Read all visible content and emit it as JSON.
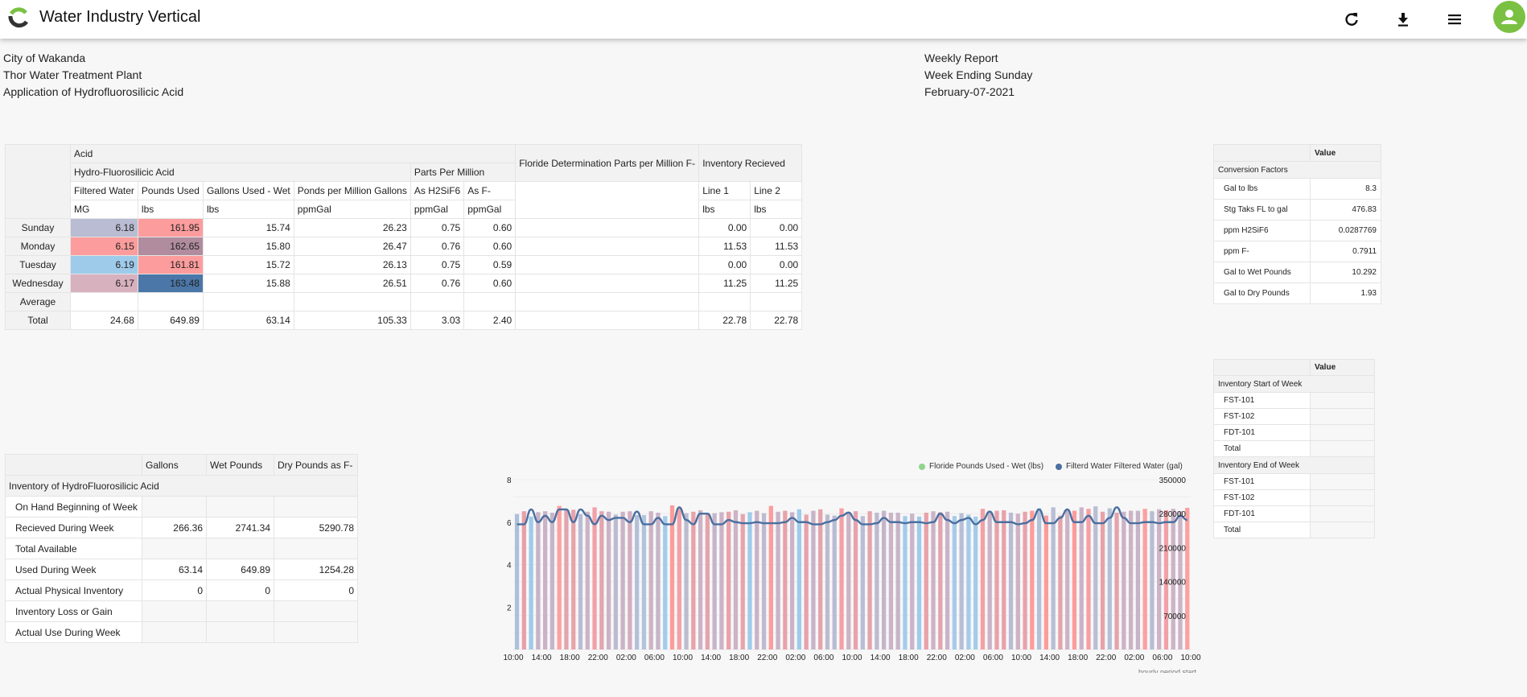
{
  "app": {
    "title": "Water Industry Vertical",
    "icons": [
      "refresh-icon",
      "download-icon",
      "menu-icon",
      "user-icon"
    ]
  },
  "header": {
    "left": [
      "City of Wakanda",
      "Thor Water Treatment Plant",
      "Application of Hydrofluorosilicic Acid"
    ],
    "right": [
      "Weekly Report",
      "Week Ending Sunday",
      "February-07-2021"
    ]
  },
  "main_table": {
    "group1": "Acid",
    "group2a": "Hydro-Fluorosilicic Acid",
    "group2b": "Parts Per Million",
    "floride_col": "Floride Determination Parts per Million F-",
    "inventory_col": "Inventory Recieved",
    "columns": [
      "Filtered Water",
      "Pounds Used",
      "Gallons Used - Wet",
      "Ponds per Million Gallons",
      "As H2SiF6",
      "As F-",
      "",
      "Line 1",
      "Line 2"
    ],
    "units": [
      "MG",
      "lbs",
      "lbs",
      "ppmGal",
      "ppmGal",
      "ppmGal",
      "",
      "lbs",
      "lbs"
    ],
    "rows": [
      {
        "label": "Sunday",
        "values": [
          "6.18",
          "161.95",
          "15.74",
          "26.23",
          "0.75",
          "0.60",
          "",
          "0.00",
          "0.00"
        ],
        "colors": [
          "#b9bcd3",
          "#fc9c9c"
        ]
      },
      {
        "label": "Monday",
        "values": [
          "6.15",
          "162.65",
          "15.80",
          "26.47",
          "0.76",
          "0.60",
          "",
          "11.53",
          "11.53"
        ],
        "colors": [
          "#fc9c9c",
          "#b08c9e"
        ]
      },
      {
        "label": "Tuesday",
        "values": [
          "6.19",
          "161.81",
          "15.72",
          "26.13",
          "0.75",
          "0.59",
          "",
          "0.00",
          "0.00"
        ],
        "colors": [
          "#9fcbea",
          "#fc9c9c"
        ]
      },
      {
        "label": "Wednesday",
        "values": [
          "6.17",
          "163.48",
          "15.88",
          "26.51",
          "0.76",
          "0.60",
          "",
          "11.25",
          "11.25"
        ],
        "colors": [
          "#d8b1bf",
          "#4a77a8"
        ]
      },
      {
        "label": "Average",
        "values": [
          "",
          "",
          "",
          "",
          "",
          "",
          "",
          "",
          ""
        ],
        "colors": [
          "",
          ""
        ]
      },
      {
        "label": "Total",
        "values": [
          "24.68",
          "649.89",
          "63.14",
          "105.33",
          "3.03",
          "2.40",
          "",
          "22.78",
          "22.78"
        ],
        "colors": [
          "",
          ""
        ]
      }
    ]
  },
  "inventory_table": {
    "columns": [
      "Gallons",
      "Wet Pounds",
      "Dry Pounds as F-"
    ],
    "section": "Inventory of HydroFluorosilicic Acid",
    "rows": [
      {
        "label": "On Hand Beginning of Week",
        "values": [
          "",
          "",
          ""
        ]
      },
      {
        "label": "Recieved During Week",
        "values": [
          "266.36",
          "2741.34",
          "5290.78"
        ]
      },
      {
        "label": "Total Available",
        "values": [
          "",
          "",
          ""
        ]
      },
      {
        "label": "Used During Week",
        "values": [
          "63.14",
          "649.89",
          "1254.28"
        ]
      },
      {
        "label": "Actual Physical Inventory",
        "values": [
          "0",
          "0",
          "0"
        ]
      },
      {
        "label": "Inventory Loss or Gain",
        "values": [
          "",
          "",
          ""
        ]
      },
      {
        "label": "Actual Use During Week",
        "values": [
          "",
          "",
          ""
        ]
      }
    ]
  },
  "conversion_table": {
    "value_header": "Value",
    "section": "Conversion Factors",
    "rows": [
      {
        "label": "Gal to lbs",
        "value": "8.3"
      },
      {
        "label": "Stg Taks FL to gal",
        "value": "476.83"
      },
      {
        "label": "ppm H2SiF6",
        "value": "0.0287769"
      },
      {
        "label": "ppm F-",
        "value": "0.7911"
      },
      {
        "label": "Gal to Wet Pounds",
        "value": "10.292"
      },
      {
        "label": "Gal to Dry Pounds",
        "value": "1.93"
      }
    ]
  },
  "stock_table": {
    "value_header": "Value",
    "sections": [
      {
        "title": "Inventory Start of Week",
        "rows": [
          {
            "label": "FST-101",
            "value": ""
          },
          {
            "label": "FST-102",
            "value": ""
          },
          {
            "label": "FDT-101",
            "value": ""
          },
          {
            "label": "Total",
            "value": ""
          }
        ]
      },
      {
        "title": "Inventory End of Week",
        "rows": [
          {
            "label": "FST-101",
            "value": ""
          },
          {
            "label": "FST-102",
            "value": ""
          },
          {
            "label": "FDT-101",
            "value": ""
          },
          {
            "label": "Total",
            "value": ""
          }
        ]
      }
    ]
  },
  "chart_data": {
    "type": "bar",
    "title": "",
    "xlabel": "hourly period start",
    "legend": [
      {
        "name": "Floride Pounds Used - Wet (lbs)",
        "color": "#8fd48a"
      },
      {
        "name": "Filterd Water Filtered Water (gal)",
        "color": "#4a6fa0"
      }
    ],
    "legend_position": "top-right",
    "x_tick_labels": [
      "10:00",
      "14:00",
      "18:00",
      "22:00",
      "02:00",
      "06:00",
      "10:00",
      "14:00",
      "18:00",
      "22:00",
      "02:00",
      "06:00",
      "10:00",
      "14:00",
      "18:00",
      "22:00",
      "02:00",
      "06:00",
      "10:00",
      "14:00",
      "18:00",
      "22:00",
      "02:00",
      "06:00",
      "10:00"
    ],
    "y_left": {
      "ticks": [
        2,
        4,
        6,
        8
      ],
      "range": [
        0,
        8
      ]
    },
    "y_right": {
      "ticks": [
        70000,
        140000,
        210000,
        280000,
        350000
      ],
      "range": [
        0,
        350000
      ]
    },
    "grid": true,
    "series": [
      {
        "name": "Filterd Water Filtered Water (gal)",
        "type": "bar",
        "axis": "right",
        "values": [
          279000,
          285000,
          274000,
          283000,
          285000,
          282000,
          296000,
          288000,
          288000,
          279000,
          284000,
          293000,
          285000,
          284000,
          278000,
          284000,
          285000,
          277000,
          277000,
          285000,
          282000,
          275000,
          297000,
          291000,
          281000,
          284000,
          287000,
          281000,
          281000,
          283000,
          284000,
          287000,
          279000,
          283000,
          286000,
          281000,
          296000,
          284000,
          286000,
          283000,
          289000,
          278000,
          286000,
          289000,
          278000,
          276000,
          291000,
          283000,
          285000,
          275000,
          285000,
          282000,
          286000,
          282000,
          282000,
          275000,
          280000,
          274000,
          282000,
          285000,
          283000,
          284000,
          275000,
          281000,
          278000,
          274000,
          290000,
          285000,
          286000,
          287000,
          282000,
          280000,
          284000,
          286000,
          291000,
          276000,
          293000,
          276000,
          287000,
          286000,
          293000,
          290000,
          295000,
          284000,
          291000,
          282000,
          284000,
          286000,
          286000,
          290000,
          285000,
          289000,
          287000,
          290000,
          285000,
          292000
        ],
        "colors": [
          "#adc0da",
          "#e8a0a8",
          "#9fcbea",
          "#c7b3c8",
          "#cbb2c7",
          "#c3b6c9",
          "#fca0a0",
          "#e2a4ae",
          "#e8a3ab",
          "#b9bcd3",
          "#ccb3c6",
          "#f2a0a8",
          "#e2a5ae",
          "#cbb3c7",
          "#bdbbd0",
          "#cbb3c7",
          "#d3aebf",
          "#b3c1d8",
          "#b0c4dc",
          "#ceb2c5",
          "#c8b4c9",
          "#a3ccea",
          "#fc9c9c",
          "#f1a2a8",
          "#bdbbd0",
          "#e8a2aa",
          "#ccb3c6",
          "#e5a3ac",
          "#c6b5ca",
          "#cdb3c6",
          "#e8a2aa",
          "#ccb3c6",
          "#e6a4ad",
          "#9fcbea",
          "#ccb2c6",
          "#bfbad0",
          "#fc9c9c",
          "#c7b4c8",
          "#e8a2aa",
          "#cbb3c7",
          "#9fcbea",
          "#e6a3ac",
          "#c8b4c9",
          "#e5a3ac",
          "#bdbbd0",
          "#b9bcd3",
          "#f5a0a6",
          "#ccb3c6",
          "#e6a3ac",
          "#b7bed5",
          "#e5a3ac",
          "#bdbbd0",
          "#c6b5ca",
          "#ccb3c6",
          "#c8b4c9",
          "#a3ccea",
          "#c9b4c8",
          "#a0cbea",
          "#e8a2aa",
          "#ccb3c6",
          "#e2a4ae",
          "#c8b4c9",
          "#a8caea",
          "#b6bfd6",
          "#a5cbea",
          "#a4ccea",
          "#f5a0a6",
          "#cbb3c7",
          "#e8a2aa",
          "#e8a2aa",
          "#b9bcd3",
          "#ceb2c5",
          "#e6a3ac",
          "#fc9c9c",
          "#b3c1d8",
          "#fc9c9c",
          "#b7bed5",
          "#e5a3ac",
          "#ccb3c6",
          "#fc9c9c",
          "#cbb3c7",
          "#f5a0a6",
          "#b7bed5",
          "#e8a2aa",
          "#b3c1d8",
          "#e5a3ac",
          "#ccb3c6",
          "#ccb3c6",
          "#c8b4c9",
          "#fca0a0",
          "#b9bcd3",
          "#ccb3c6",
          "#f2a0a8",
          "#ccb3c6",
          "#c9b4c8",
          "#fca0a0"
        ]
      },
      {
        "name": "Floride Pounds Used - Wet (lbs)",
        "type": "line",
        "axis": "left",
        "values": [
          5.9,
          5.9,
          6.6,
          6.0,
          6.3,
          6.0,
          6.6,
          6.6,
          6.0,
          6.6,
          6.3,
          5.9,
          6.3,
          6.1,
          6.2,
          6.2,
          6.0,
          6.5,
          5.9,
          5.9,
          6.2,
          5.9,
          5.9,
          6.7,
          6.1,
          5.9,
          6.4,
          6.4,
          5.9,
          5.9,
          6.1,
          6.0,
          5.95,
          5.95,
          6.0,
          5.95,
          5.95,
          5.95,
          6.0,
          6.2,
          6.0,
          6.0,
          5.9,
          5.9,
          6.0,
          6.1,
          6.3,
          6.45,
          6.1,
          5.9,
          5.9,
          5.95,
          6.2,
          6.0,
          6.0,
          5.95,
          6.0,
          6.0,
          5.95,
          6.0,
          6.4,
          6.1,
          5.95,
          6.1,
          6.2,
          5.9,
          6.1,
          6.5,
          6.0,
          6.0,
          6.0,
          5.9,
          5.95,
          6.1,
          6.6,
          5.95,
          5.95,
          6.2,
          6.6,
          6.0,
          6.0,
          6.3,
          5.95,
          5.95,
          6.2,
          6.7,
          6.2,
          5.95,
          5.95,
          6.0,
          6.0,
          5.95,
          6.0,
          6.0,
          6.3,
          6.1
        ]
      }
    ]
  }
}
